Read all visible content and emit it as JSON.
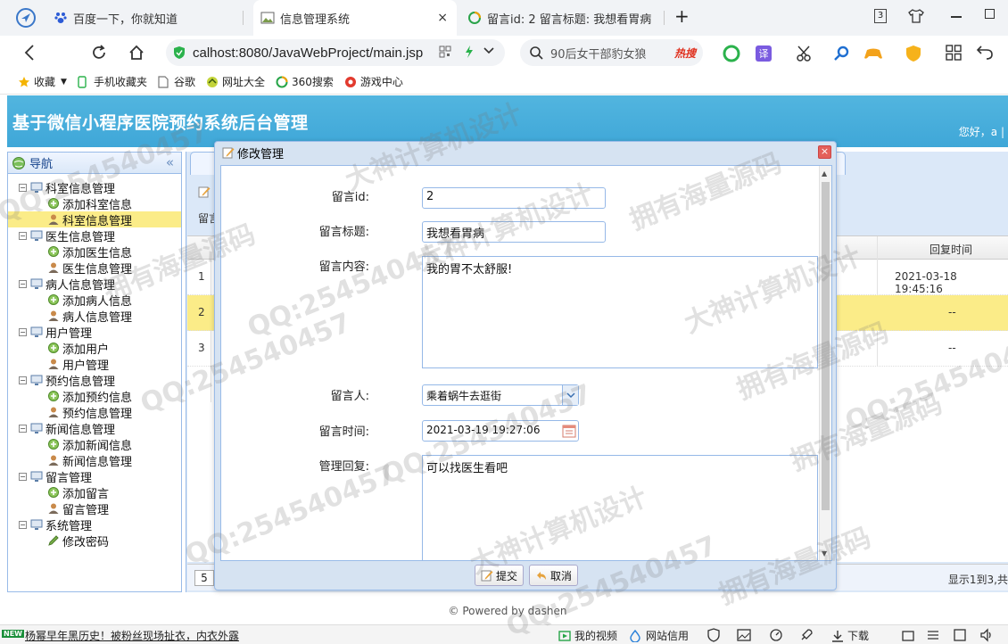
{
  "browser": {
    "tabs": [
      {
        "title": "百度一下，你就知道"
      },
      {
        "title": "信息管理系统",
        "close": "×"
      },
      {
        "title": "留言id: 2 留言标题: 我想看胃病"
      }
    ],
    "new_tab": "+",
    "tab_counter": "3",
    "address": "calhost:8080/JavaWebProject/main.jsp",
    "search_query": "90后女干部豹女狼",
    "search_hot": "热搜",
    "bookmarks": [
      "收藏",
      "手机收藏夹",
      "谷歌",
      "网址大全",
      "360搜索",
      "游戏中心"
    ]
  },
  "app": {
    "title": "基于微信小程序医院预约系统后台管理",
    "greeting": "您好，a |",
    "nav_title": "导航",
    "tree": [
      {
        "label": "科室信息管理",
        "level": 1
      },
      {
        "label": "添加科室信息",
        "level": 2
      },
      {
        "label": "科室信息管理",
        "level": 2,
        "selected": true
      },
      {
        "label": "医生信息管理",
        "level": 1
      },
      {
        "label": "添加医生信息",
        "level": 2
      },
      {
        "label": "医生信息管理",
        "level": 2
      },
      {
        "label": "病人信息管理",
        "level": 1
      },
      {
        "label": "添加病人信息",
        "level": 2
      },
      {
        "label": "病人信息管理",
        "level": 2
      },
      {
        "label": "用户管理",
        "level": 1
      },
      {
        "label": "添加用户",
        "level": 2
      },
      {
        "label": "用户管理",
        "level": 2
      },
      {
        "label": "预约信息管理",
        "level": 1
      },
      {
        "label": "添加预约信息",
        "level": 2
      },
      {
        "label": "预约信息管理",
        "level": 2
      },
      {
        "label": "新闻信息管理",
        "level": 1
      },
      {
        "label": "添加新闻信息",
        "level": 2
      },
      {
        "label": "新闻信息管理",
        "level": 2
      },
      {
        "label": "留言管理",
        "level": 1
      },
      {
        "label": "添加留言",
        "level": 2
      },
      {
        "label": "留言管理",
        "level": 2
      },
      {
        "label": "系统管理",
        "level": 1
      },
      {
        "label": "修改密码",
        "level": 2
      }
    ],
    "toolbar_label": "留言",
    "grid": {
      "reply_time_header": "回复时间",
      "rows": [
        {
          "n": "1",
          "reply_time": "2021-03-18 19:45:16"
        },
        {
          "n": "2",
          "reply_time": "--"
        },
        {
          "n": "3",
          "reply_time": "--"
        }
      ]
    },
    "pager": {
      "page_size": "5",
      "info": "显示1到3,共"
    },
    "footer": "© Powered by dashen"
  },
  "dialog": {
    "title": "修改管理",
    "close": "×",
    "fields": {
      "id_label": "留言id:",
      "id_value": "2",
      "title_label": "留言标题:",
      "title_value": "我想看胃病",
      "content_label": "留言内容:",
      "content_value": "我的胃不太舒服!",
      "user_label": "留言人:",
      "user_value": "乘着蜗牛去逛街",
      "time_label": "留言时间:",
      "time_value": "2021-03-19 19:27:06",
      "reply_label": "管理回复:",
      "reply_value": "可以找医生看吧"
    },
    "submit": "提交",
    "cancel": "取消"
  },
  "statusbar": {
    "badge": "NEW",
    "news": "杨幂早年黑历史！被粉丝现场扯衣，内衣外露",
    "items": [
      "我的视频",
      "网站信用",
      "下载"
    ]
  },
  "watermarks": [
    "QQ:254540457",
    "大神计算机设计",
    "拥有海量源码",
    "QQ:254540457",
    "大神计算机设计",
    "拥有海量源码",
    "QQ:254540457",
    "QQ:254540457",
    "拥有海量源码",
    "大神计算机设计",
    "QQ:254540457",
    "拥有海量源码",
    "QQ:254540457",
    "大神计算机设计",
    "拥有海量源码",
    "QQ:254540457"
  ],
  "colors": {
    "header": "#4fb3de",
    "selected": "#fbec88",
    "panel_border": "#99bbe8"
  }
}
